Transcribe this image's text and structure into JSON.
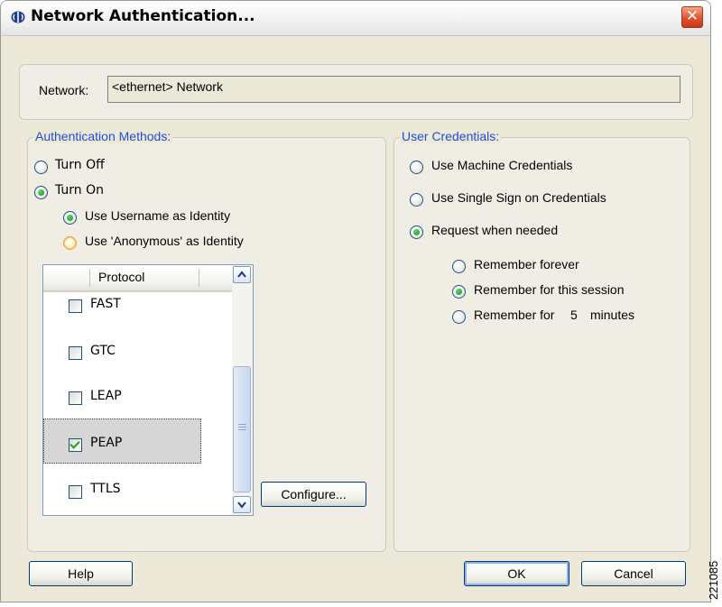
{
  "window": {
    "title": "Network Authentication...",
    "close_label": "✕"
  },
  "network": {
    "label": "Network:",
    "value": "<ethernet> Network"
  },
  "auth_methods": {
    "legend": "Authentication Methods:",
    "turn_off": "Turn Off",
    "turn_on": "Turn On",
    "use_username": "Use Username as Identity",
    "use_anonymous": "Use 'Anonymous' as Identity",
    "selected": "Turn On",
    "identity_selected": "Use Username as Identity"
  },
  "protocol_list": {
    "header": "Protocol",
    "items": [
      {
        "label": "FAST",
        "checked": false
      },
      {
        "label": "GTC",
        "checked": false
      },
      {
        "label": "LEAP",
        "checked": false
      },
      {
        "label": "PEAP",
        "checked": true
      },
      {
        "label": "TTLS",
        "checked": false
      }
    ],
    "configure_label": "Configure..."
  },
  "user_credentials": {
    "legend": "User Credentials:",
    "machine": "Use Machine Credentials",
    "sso": "Use Single Sign on Credentials",
    "request": "Request when needed",
    "remember_forever": "Remember forever",
    "remember_session": "Remember for this session",
    "remember_for": "Remember for",
    "minutes_value": "5",
    "minutes_label": "minutes",
    "selected": "Request when needed",
    "remember_selected": "Remember for this session"
  },
  "footer": {
    "help": "Help",
    "ok": "OK",
    "cancel": "Cancel"
  },
  "side_code": "221085",
  "colors": {
    "legend": "#1f4fd8",
    "dialog_bg": "#ece9d8",
    "close": "#e0502c"
  }
}
